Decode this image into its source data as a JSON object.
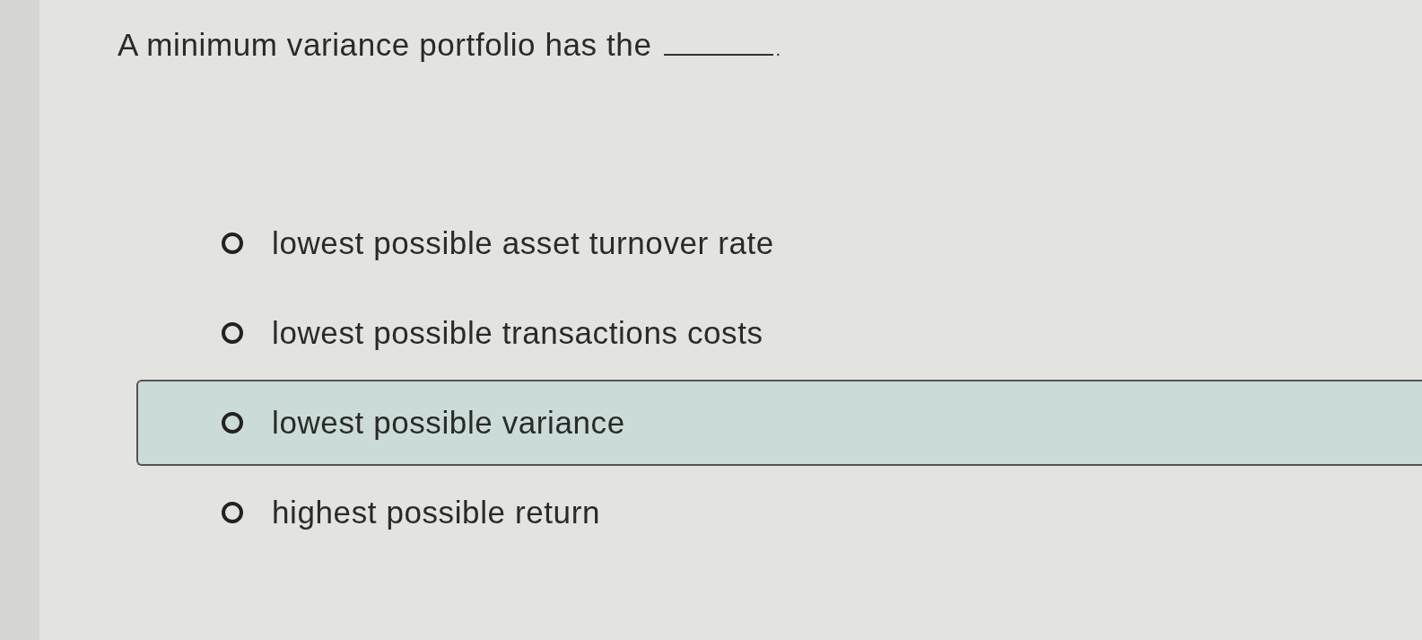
{
  "question": {
    "before_blank": "A minimum variance portfolio has the",
    "after_blank": "."
  },
  "options": [
    {
      "label": "lowest possible asset turnover rate",
      "selected": false,
      "highlighted": false
    },
    {
      "label": "lowest possible transactions costs",
      "selected": false,
      "highlighted": false
    },
    {
      "label": "lowest possible variance",
      "selected": false,
      "highlighted": true
    },
    {
      "label": "highest possible return",
      "selected": false,
      "highlighted": false
    }
  ]
}
